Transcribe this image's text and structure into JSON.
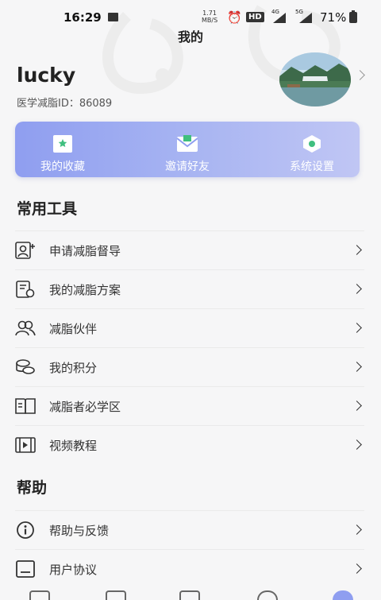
{
  "status_bar": {
    "time": "16:29",
    "net_speed_value": "1.71",
    "net_speed_unit": "MB/S",
    "hd_label": "HD",
    "net_type_1": "4G",
    "net_type_2": "5G",
    "battery": "71%"
  },
  "page_title": "我的",
  "profile": {
    "username": "lucky",
    "user_id": "医学减脂ID：86089"
  },
  "quick_actions": [
    {
      "label": "我的收藏",
      "icon": "bookmark-icon"
    },
    {
      "label": "邀请好友",
      "icon": "envelope-icon"
    },
    {
      "label": "系统设置",
      "icon": "settings-hexagon-icon"
    }
  ],
  "sections": {
    "tools_title": "常用工具",
    "help_title": "帮助"
  },
  "tools": [
    {
      "label": "申请减脂督导",
      "icon": "add-user-icon"
    },
    {
      "label": "我的减脂方案",
      "icon": "plan-document-icon"
    },
    {
      "label": "减脂伙伴",
      "icon": "partners-icon"
    },
    {
      "label": "我的积分",
      "icon": "coins-icon"
    },
    {
      "label": "减脂者必学区",
      "icon": "book-icon"
    },
    {
      "label": "视频教程",
      "icon": "video-icon"
    }
  ],
  "help": [
    {
      "label": "帮助与反馈",
      "icon": "info-icon"
    },
    {
      "label": "用户协议",
      "icon": "agreement-icon"
    }
  ],
  "colors": {
    "accent": "#8f9ef0",
    "accent_light": "#c0c6f4",
    "icon_green": "#3fbf7f"
  }
}
